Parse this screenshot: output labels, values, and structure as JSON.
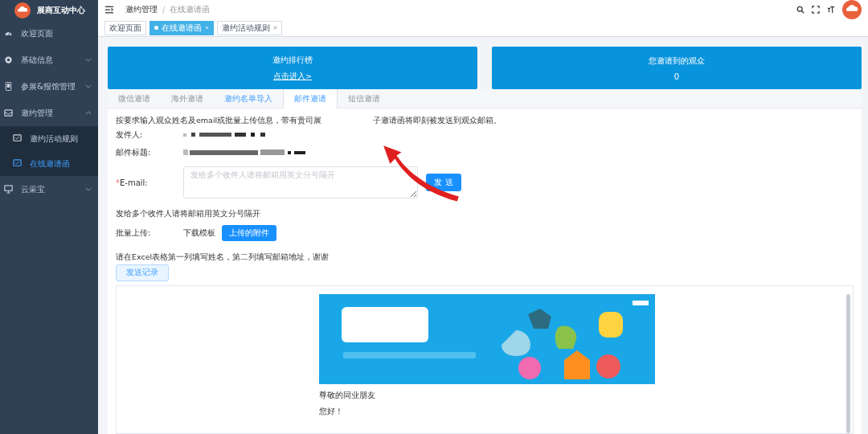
{
  "sidebar": {
    "title": "展商互动中心",
    "items": [
      {
        "label": "欢迎页面",
        "expandable": false
      },
      {
        "label": "基础信息",
        "expandable": true,
        "expanded": false
      },
      {
        "label": "参展&报馆管理",
        "expandable": true,
        "expanded": false
      },
      {
        "label": "邀约管理",
        "expandable": true,
        "expanded": true,
        "children": [
          {
            "label": "邀约活动规则",
            "selected": false
          },
          {
            "label": "在线邀请函",
            "selected": true
          }
        ]
      },
      {
        "label": "云采宝",
        "expandable": true,
        "expanded": false
      }
    ]
  },
  "breadcrumb": [
    "邀约管理",
    "在线邀请函"
  ],
  "breadcrumb_separator": "/",
  "tags": [
    {
      "label": "欢迎页面",
      "selected": false,
      "closable": false
    },
    {
      "label": "在线邀请函",
      "selected": true,
      "closable": true
    },
    {
      "label": "邀约活动规则",
      "selected": false,
      "closable": true
    }
  ],
  "cards": [
    {
      "title": "邀约排行榜",
      "link": "点击进入>"
    },
    {
      "title": "您邀请到的观众",
      "value": "0"
    }
  ],
  "tabs": [
    {
      "label": "微信邀请",
      "selected": false,
      "hovered": false
    },
    {
      "label": "海外邀请",
      "selected": false,
      "hovered": false
    },
    {
      "label": "邀约名单导入",
      "selected": false,
      "hovered": true
    },
    {
      "label": "邮件邀请",
      "selected": true,
      "hovered": false
    },
    {
      "label": "短信邀请",
      "selected": false,
      "hovered": false
    }
  ],
  "form": {
    "intro_before": "按要求输入观众姓名及email或批量上传信息，带有贵司展",
    "intro_after": "子邀请函将即刻被发送到观众邮箱。",
    "sender_label": "发件人:",
    "subject_label": "邮件标题:",
    "email_label": "E-mail:",
    "email_required_mark": "*",
    "email_placeholder": "发给多个收件人请将邮箱用英文分号隔开",
    "send_button": "发 送",
    "hint": "发给多个收件人请将邮箱用英文分号隔开",
    "upload_label": "批量上传:",
    "template_link": "下载模板",
    "upload_button": "上传的附件",
    "excel_note": "请在Excel表格第一列填写姓名，第二列填写邮箱地址，谢谢",
    "records_button": "发送记录"
  },
  "preview": {
    "greeting": "尊敬的同业朋友",
    "salutation": "您好！"
  }
}
